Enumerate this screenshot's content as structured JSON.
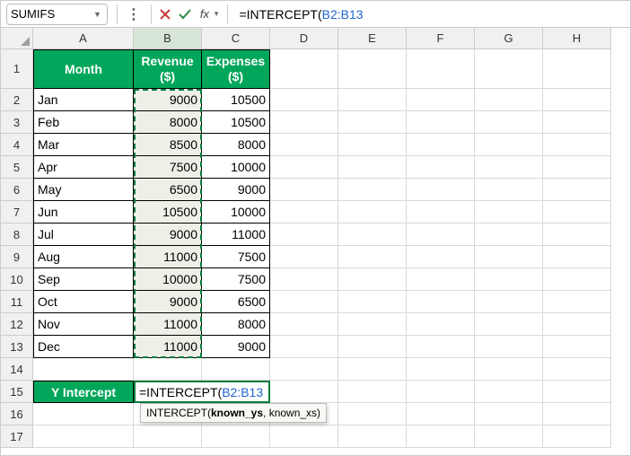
{
  "namebox": {
    "value": "SUMIFS"
  },
  "formula_bar": {
    "prefix": "=INTERCEPT(",
    "ref": "B2:B13"
  },
  "columns": [
    "A",
    "B",
    "C",
    "D",
    "E",
    "F",
    "G",
    "H"
  ],
  "headers": {
    "A": "Month",
    "B": "Revenue ($)",
    "C": "Expenses ($)"
  },
  "rows": [
    {
      "n": 2,
      "A": "Jan",
      "B": 9000,
      "C": 10500
    },
    {
      "n": 3,
      "A": "Feb",
      "B": 8000,
      "C": 10500
    },
    {
      "n": 4,
      "A": "Mar",
      "B": 8500,
      "C": 8000
    },
    {
      "n": 5,
      "A": "Apr",
      "B": 7500,
      "C": 10000
    },
    {
      "n": 6,
      "A": "May",
      "B": 6500,
      "C": 9000
    },
    {
      "n": 7,
      "A": "Jun",
      "B": 10500,
      "C": 10000
    },
    {
      "n": 8,
      "A": "Jul",
      "B": 9000,
      "C": 11000
    },
    {
      "n": 9,
      "A": "Aug",
      "B": 11000,
      "C": 7500
    },
    {
      "n": 10,
      "A": "Sep",
      "B": 10000,
      "C": 7500
    },
    {
      "n": 11,
      "A": "Oct",
      "B": 9000,
      "C": 6500
    },
    {
      "n": 12,
      "A": "Nov",
      "B": 11000,
      "C": 8000
    },
    {
      "n": 13,
      "A": "Dec",
      "B": 11000,
      "C": 9000
    }
  ],
  "y_intercept_label": "Y Intercept",
  "editing_cell": {
    "prefix": "=INTERCEPT(",
    "ref": "B2:B13"
  },
  "tooltip": {
    "fn": "INTERCEPT(",
    "bold": "known_ys",
    "rest": ", known_xs)"
  },
  "row_nums_tail": [
    14,
    15,
    16,
    17
  ],
  "chart_data": {
    "type": "table",
    "categories": [
      "Jan",
      "Feb",
      "Mar",
      "Apr",
      "May",
      "Jun",
      "Jul",
      "Aug",
      "Sep",
      "Oct",
      "Nov",
      "Dec"
    ],
    "series": [
      {
        "name": "Revenue ($)",
        "values": [
          9000,
          8000,
          8500,
          7500,
          6500,
          10500,
          9000,
          11000,
          10000,
          9000,
          11000,
          11000
        ]
      },
      {
        "name": "Expenses ($)",
        "values": [
          10500,
          10500,
          8000,
          10000,
          9000,
          10000,
          11000,
          7500,
          7500,
          6500,
          8000,
          9000
        ]
      }
    ]
  },
  "colors": {
    "header_green": "#00a65a",
    "selection": "#0a7c3e"
  }
}
